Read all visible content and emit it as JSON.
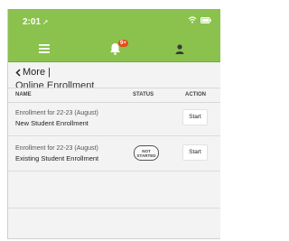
{
  "status_bar": {
    "time": "2:01",
    "location_icon": "location-arrow-icon",
    "wifi_icon": "wifi-icon",
    "battery_icon": "battery-icon"
  },
  "navbar": {
    "menu_icon": "menu-icon",
    "notifications_icon": "bell-icon",
    "notifications_badge": "9+",
    "profile_icon": "user-icon",
    "accent_color": "#8ac24d"
  },
  "breadcrumb": {
    "back_label": "More |",
    "back_icon": "chevron-left-icon"
  },
  "page": {
    "title": "Online Enrollment"
  },
  "table": {
    "headers": {
      "name": "NAME",
      "status": "STATUS",
      "action": "ACTION"
    },
    "rows": [
      {
        "line1": "Enrollment for 22-23 (August)",
        "line2": "New Student Enrollment",
        "status_line1": "",
        "status_line2": "",
        "action": "Start"
      },
      {
        "line1": "Enrollment for 22-23 (August)",
        "line2": "Existing Student Enrollment",
        "status_line1": "NOT",
        "status_line2": "STARTED",
        "action": "Start"
      }
    ]
  }
}
